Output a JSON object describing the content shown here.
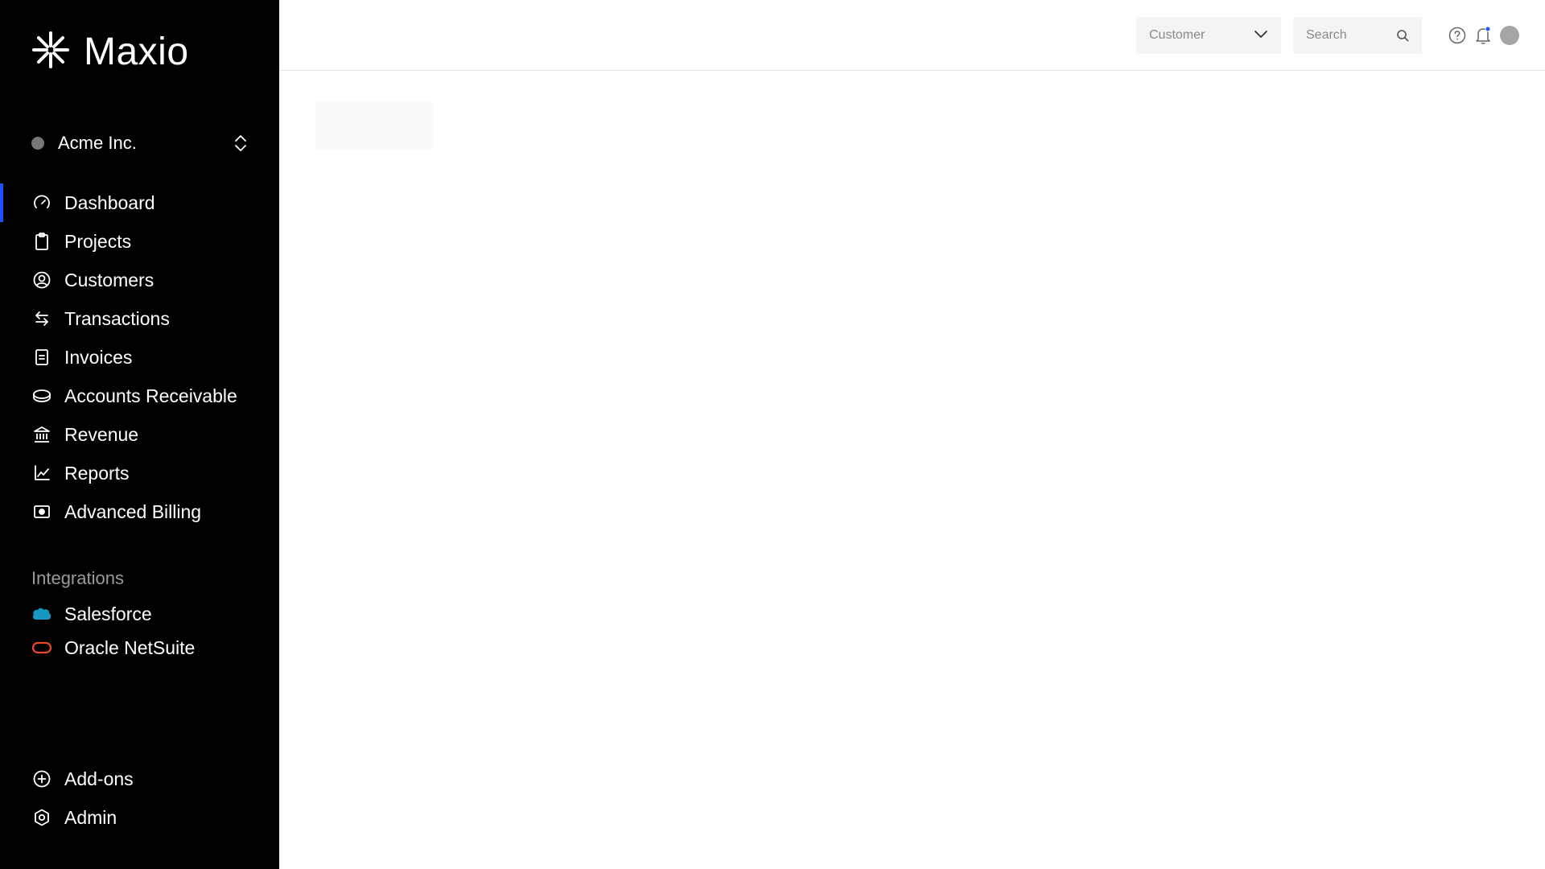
{
  "brand": {
    "name": "Maxio",
    "logo_icon": "asterisk-logo-icon"
  },
  "org_switcher": {
    "name": "Acme Inc.",
    "status_color": "#777777",
    "toggle_icon": "chevron-up-down-icon"
  },
  "sidebar": {
    "accent_color": "#1f4fff",
    "active_item": "Dashboard",
    "items": [
      {
        "label": "Dashboard",
        "icon": "gauge-icon"
      },
      {
        "label": "Projects",
        "icon": "clipboard-icon"
      },
      {
        "label": "Customers",
        "icon": "user-circle-icon"
      },
      {
        "label": "Transactions",
        "icon": "arrows-swap-icon"
      },
      {
        "label": "Invoices",
        "icon": "document-icon"
      },
      {
        "label": "Accounts Receivable",
        "icon": "coins-icon"
      },
      {
        "label": "Revenue",
        "icon": "bank-icon"
      },
      {
        "label": "Reports",
        "icon": "line-chart-icon"
      },
      {
        "label": "Advanced Billing",
        "icon": "money-icon"
      }
    ],
    "integrations_title": "Integrations",
    "integrations": [
      {
        "label": "Salesforce",
        "icon": "salesforce-cloud-icon",
        "color": "#1798c1"
      },
      {
        "label": "Oracle NetSuite",
        "icon": "oracle-icon",
        "color": "#e8492b"
      }
    ],
    "bottom_items": [
      {
        "label": "Add-ons",
        "icon": "plus-circle-icon"
      },
      {
        "label": "Admin",
        "icon": "gear-icon"
      }
    ]
  },
  "topbar": {
    "customer_select": {
      "value": "Customer",
      "icon": "chevron-down-icon"
    },
    "search": {
      "placeholder": "Search",
      "icon": "search-icon"
    },
    "help_icon": "help-circle-icon",
    "notifications": {
      "icon": "bell-icon",
      "badge_color": "#1f4fff"
    },
    "avatar_color": "#a6a6a6"
  }
}
